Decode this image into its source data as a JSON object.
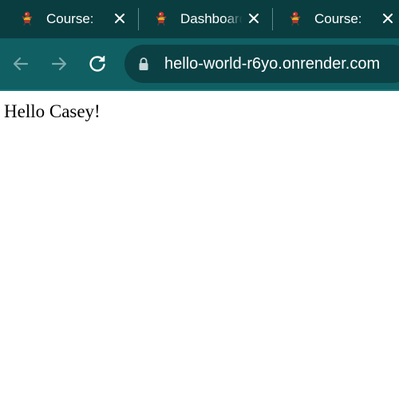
{
  "browser": {
    "tabs": [
      {
        "title": "Course: ",
        "favicon": "mascot-icon",
        "close_icon": "close-icon"
      },
      {
        "title": "Dashboard",
        "favicon": "mascot-icon",
        "close_icon": "close-icon"
      },
      {
        "title": "Course: ",
        "favicon": "mascot-icon",
        "close_icon": "close-icon"
      }
    ],
    "toolbar": {
      "back_icon": "back-arrow-icon",
      "forward_icon": "forward-arrow-icon",
      "reload_icon": "reload-icon"
    },
    "address_bar": {
      "security_icon": "lock-icon",
      "url": "hello-world-r6yo.onrender.com"
    }
  },
  "page": {
    "greeting": "Hello Casey!"
  },
  "colors": {
    "tab_strip": "#0a3d40",
    "toolbar": "#0f5f63",
    "omnibox": "#0b4144",
    "text_light": "#ffffff"
  }
}
